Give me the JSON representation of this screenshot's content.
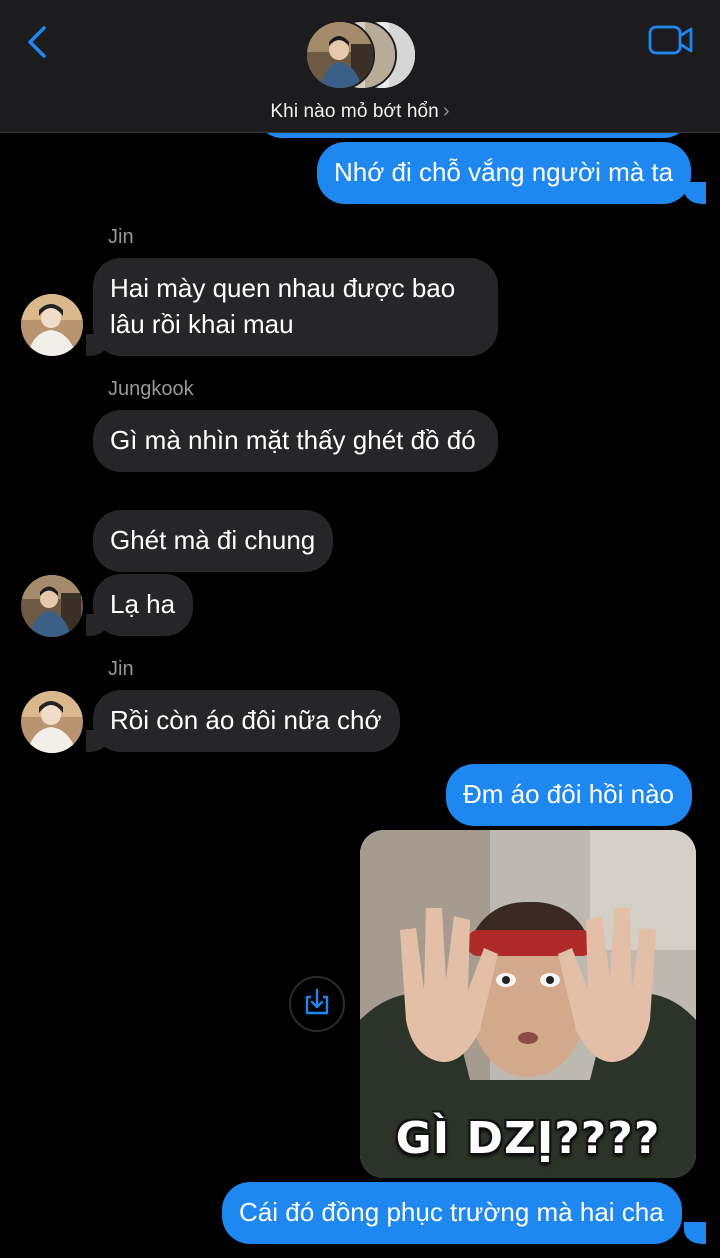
{
  "header": {
    "title": "Khi nào mỏ bớt hổn",
    "back_icon": "chevron-left-icon",
    "video_icon": "video-camera-icon",
    "accent_color": "#1e88f0"
  },
  "messages": [
    {
      "id": "m1",
      "direction": "outgoing",
      "text": "Nhớ đi chỗ vắng người mà ta"
    },
    {
      "id": "m2",
      "direction": "incoming",
      "sender": "Jin",
      "text": "Hai mày quen nhau được bao lâu rồi khai mau"
    },
    {
      "id": "m3",
      "direction": "incoming",
      "sender": "Jungkook",
      "text": "Gì mà nhìn mặt thấy ghét đồ đó"
    },
    {
      "id": "m4",
      "direction": "incoming",
      "text": "Ghét mà đi chung"
    },
    {
      "id": "m5",
      "direction": "incoming",
      "text": "Lạ ha"
    },
    {
      "id": "m6",
      "direction": "incoming",
      "sender": "Jin",
      "text": "Rồi còn áo đôi nữa chớ"
    },
    {
      "id": "m7",
      "direction": "outgoing",
      "text": "Đm áo đôi hồi nào"
    },
    {
      "id": "m8",
      "direction": "outgoing",
      "type": "image",
      "caption": "GÌ DZỊ????"
    },
    {
      "id": "m9",
      "direction": "outgoing",
      "text": "Cái đó đồng phục trường mà hai cha"
    }
  ],
  "senders": {
    "jin": "Jin",
    "jungkook": "Jungkook"
  },
  "colors": {
    "outgoing_bubble": "#1e88f0",
    "incoming_bubble": "#262628",
    "background": "#000000",
    "sender_label": "#98989d"
  }
}
